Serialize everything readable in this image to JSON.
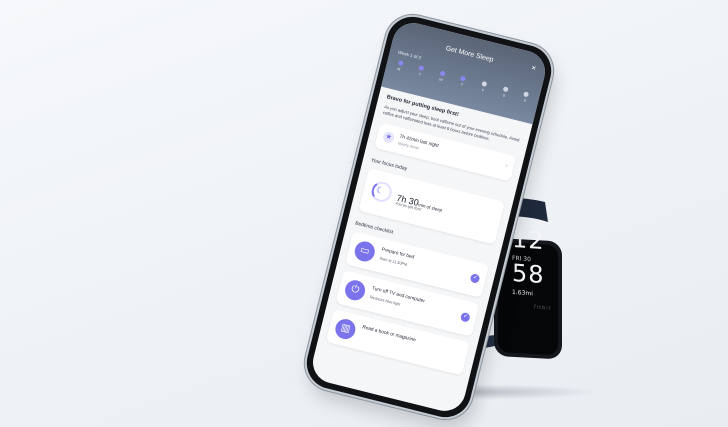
{
  "header": {
    "title": "Get More Sleep",
    "week": "Week 1 of 2",
    "days": [
      "M",
      "T",
      "W",
      "T",
      "F",
      "S",
      "S"
    ]
  },
  "intro": {
    "title": "Bravo for putting sleep first!",
    "body": "As you adjust your sleep, boot caffeine out of your evening schedule. Avoid coffee and caffeinated teas at least 6 hours before bedtime."
  },
  "last_night": {
    "main": "7h 42min last night",
    "sub": "Nearly done!"
  },
  "focus": {
    "heading": "Your focus today",
    "hours": "7h 30",
    "unit": "min of sleep",
    "sub": "You've got this!"
  },
  "checklist": {
    "heading": "Bedtime checklist",
    "items": [
      {
        "title": "Prepare for bed",
        "sub": "Start at 11:30PM"
      },
      {
        "title": "Turn off TV and computer",
        "sub": "Reduces blue light"
      },
      {
        "title": "Read a book or magazine",
        "sub": ""
      }
    ]
  },
  "tracker": {
    "hour": "12",
    "date": "FRI 30",
    "minute": "58",
    "steps": "1.63mi",
    "brand": "fitbit"
  }
}
